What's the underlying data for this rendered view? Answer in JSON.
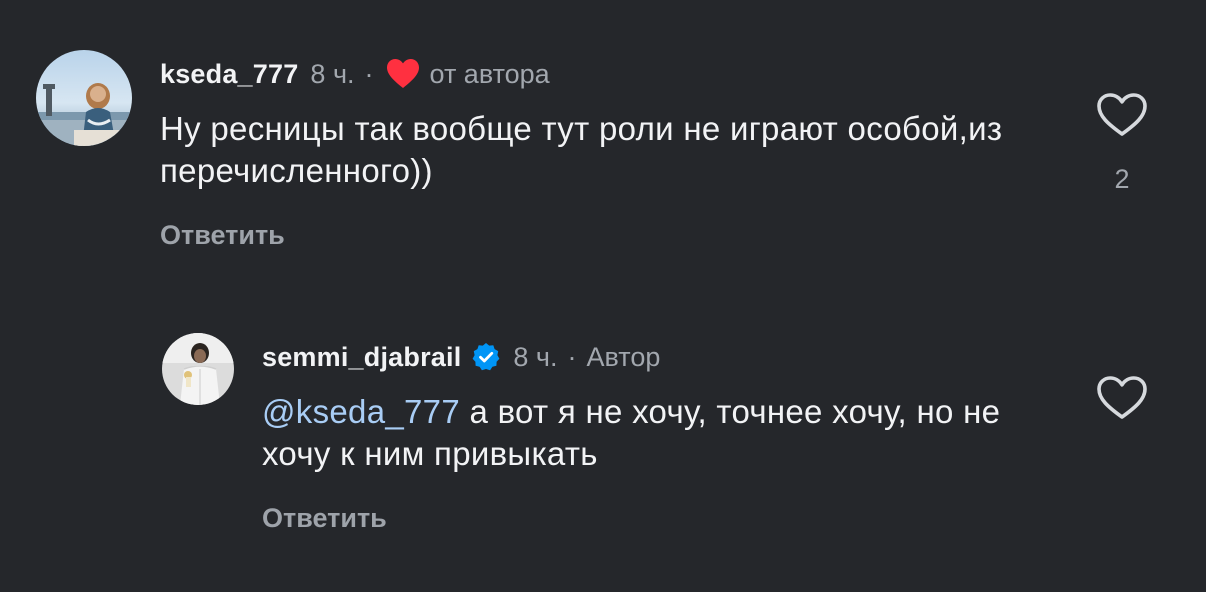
{
  "comments": [
    {
      "username": "kseda_777",
      "time": "8 ч.",
      "separator": "·",
      "author_like_label": "от автора",
      "text": "Ну ресницы так вообще тут роли не играют особой,из перечисленного))",
      "reply_label": "Ответить",
      "like_count": "2",
      "author_like_color": "#ff3040"
    },
    {
      "username": "semmi_djabrail",
      "time": "8 ч.",
      "separator": "·",
      "author_badge": "Автор",
      "mention": "@kseda_777",
      "text": "а вот я не хочу, точнее хочу, но не хочу к ним привыкать",
      "reply_label": "Ответить",
      "verified_color": "#0095f6"
    }
  ],
  "colors": {
    "background": "#25272b",
    "text": "#f2f3f5",
    "muted": "#a2a7ae",
    "mention": "#a9cdf5"
  },
  "icons": {
    "like": "heart-outline-icon",
    "author_like": "heart-filled-icon",
    "verified": "verified-badge-icon"
  }
}
